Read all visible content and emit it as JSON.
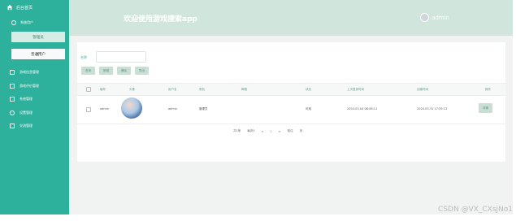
{
  "brand": {
    "text": "后台首页"
  },
  "nav": {
    "group_label": "系统用户",
    "sub_items": [
      "管理员",
      "普通用户"
    ],
    "items": [
      "游戏信息管理",
      "游戏评价管理",
      "系统管理",
      "设置管理",
      "交流管理"
    ]
  },
  "header": {
    "title": "欢迎使用游戏搜索app",
    "username": "admin"
  },
  "search": {
    "label": "名称"
  },
  "buttons": [
    "查询",
    "新增",
    "删除",
    "导出"
  ],
  "table": {
    "headers": [
      "编号",
      "头像",
      "用户名",
      "角色",
      "邮箱",
      "状态",
      "上次登录时间",
      "创建时间",
      "操作"
    ],
    "row": {
      "id": "admin",
      "username": "admin",
      "role": "管理员",
      "email": "",
      "status": "可用",
      "last_login": "2024-03-04 08:56:11",
      "created": "2024-03-31 17:35:13",
      "action": "详情"
    }
  },
  "pager": {
    "total": "共1条",
    "per_page": "每页5",
    "prev": "<",
    "page": "1",
    "next": ">",
    "goto": "前往",
    "page_unit": "页"
  },
  "watermark": "CSDN @VX_CXsjNo1",
  "colors": {
    "primary": "#2db09c",
    "header_bg": "#d0e6dc",
    "button_bg": "#c9dfd6"
  }
}
